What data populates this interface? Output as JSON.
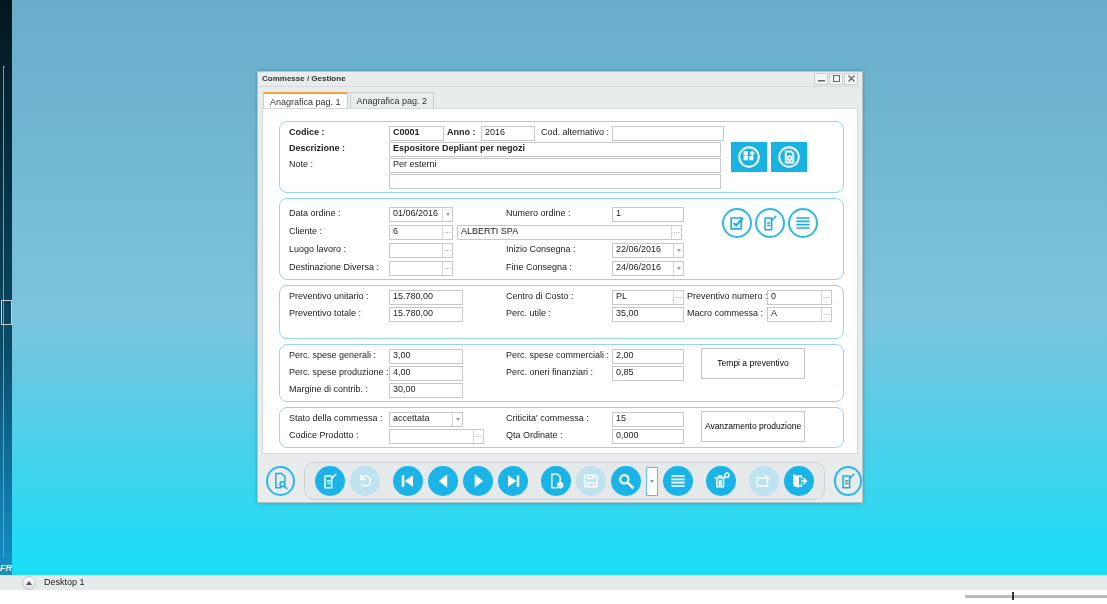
{
  "side_strip": {
    "label": "FR"
  },
  "window": {
    "title": "Commesse / Gestione"
  },
  "tabs": [
    {
      "label": "Anagrafica pag. 1",
      "selected": true
    },
    {
      "label": "Anagrafica pag. 2",
      "selected": false
    }
  ],
  "header": {
    "codice": {
      "label": "Codice :",
      "value": "C0001"
    },
    "anno": {
      "label": "Anno :",
      "value": "2016"
    },
    "cod_alternativo": {
      "label": "Cod. alternativo :"
    },
    "descrizione": {
      "label": "Descrizione :",
      "value": "Espositore Depliant per negozi"
    },
    "note": {
      "label": "Note :",
      "value": "Per esterni"
    },
    "icon_buttons": [
      {
        "disabled": false
      },
      {
        "disabled": false
      }
    ]
  },
  "sections": [
    {
      "rows": [
        [
          {
            "label": "Data ordine :",
            "value": "01/06/2016",
            "kind": "combo"
          },
          {
            "label": "Numero ordine :",
            "value": "1",
            "kind": "text"
          }
        ],
        [
          {
            "label": "Cliente :",
            "value": "6",
            "kind": "lookup",
            "name": "ALBERTI SPA"
          }
        ],
        [
          {
            "label": "Luogo lavoro :",
            "kind": "lookup"
          },
          {
            "label": "Inizio Consegna :",
            "value": "22/06/2016",
            "kind": "combo"
          }
        ],
        [
          {
            "label": "Destinazione Diversa :",
            "kind": "lookup"
          },
          {
            "label": "Fine Consegna :",
            "value": "24/06/2016",
            "kind": "combo"
          }
        ]
      ],
      "icon_buttons": [
        {
          "disabled": false
        },
        {
          "disabled": false
        },
        {
          "disabled": false
        }
      ]
    },
    {
      "rows": [
        [
          {
            "label": "Preventivo unitario :",
            "value": "15.780,00",
            "kind": "text"
          },
          {
            "label": "Centro di Costo :",
            "value": "PL",
            "kind": "lookup"
          },
          {
            "label": "Preventivo numero :",
            "value": "0",
            "kind": "lookup"
          }
        ],
        [
          {
            "label": "Preventivo totale :",
            "value": "15.780,00",
            "kind": "text"
          },
          {
            "label": "Perc. utile :",
            "value": "35,00",
            "kind": "text"
          },
          {
            "label": "Macro commessa :",
            "value": "A",
            "kind": "lookup"
          }
        ]
      ]
    },
    {
      "rows": [
        [
          {
            "label": "Perc. spese generali :",
            "value": "3,00",
            "kind": "text"
          },
          {
            "label": "Perc. spese commerciali :",
            "value": "2,00",
            "kind": "text"
          }
        ],
        [
          {
            "label": "Perc. spese produzione :",
            "value": "4,00",
            "kind": "text"
          },
          {
            "label": "Perc. oneri finanziari :",
            "value": "0,85",
            "kind": "text"
          }
        ],
        [
          {
            "label": "Margine di contrib. :",
            "value": "30,00",
            "kind": "text"
          }
        ]
      ],
      "button": "Tempi a preventivo"
    },
    {
      "rows": [
        [
          {
            "label": "Stato della commessa :",
            "value": "accettata",
            "kind": "combo"
          },
          {
            "label": "Criticita' commessa :",
            "value": "15",
            "kind": "text"
          }
        ],
        [
          {
            "label": "Codice Prodotto :",
            "kind": "lookup"
          },
          {
            "label": "Qta Ordinate :",
            "value": "0,000",
            "kind": "text"
          }
        ]
      ],
      "button": "Avanzamento produzione"
    }
  ],
  "toolbar": {
    "left": [
      {
        "kind": "outline",
        "disabled": false
      }
    ],
    "group": [
      {
        "kind": "round",
        "disabled": false
      },
      {
        "kind": "round",
        "disabled": true
      },
      {
        "kind": "round",
        "disabled": false
      },
      {
        "kind": "round",
        "disabled": false
      },
      {
        "kind": "round",
        "disabled": false
      },
      {
        "kind": "round",
        "disabled": false
      },
      {
        "kind": "round",
        "disabled": false
      },
      {
        "kind": "round",
        "disabled": true
      },
      {
        "kind": "round",
        "disabled": false
      },
      {
        "kind": "dropdown",
        "disabled": false
      },
      {
        "kind": "round",
        "disabled": false
      },
      {
        "kind": "round",
        "disabled": false
      },
      {
        "kind": "round",
        "disabled": true
      },
      {
        "kind": "round",
        "disabled": false
      }
    ],
    "right": [
      {
        "kind": "outline",
        "disabled": false
      }
    ]
  },
  "taskbar": {
    "label": "Desktop 1"
  },
  "zoom_slider": {
    "level": 0.33
  }
}
